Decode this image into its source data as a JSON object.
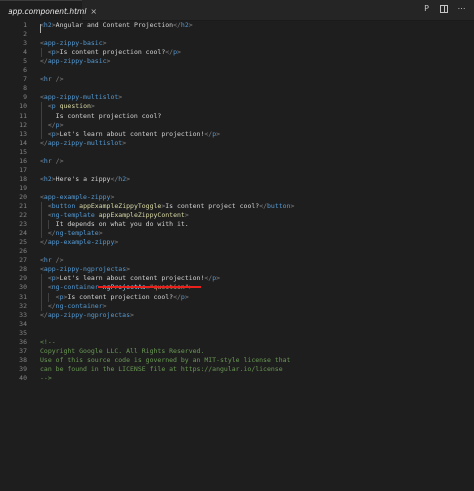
{
  "tab": {
    "filename": "app.component.html",
    "close": "×"
  },
  "toolbar": {
    "preview_icon": "P",
    "split_icon": "split-editor",
    "more_icon": "⋯"
  },
  "lines": [
    {
      "n": "1",
      "code": [
        [
          "br",
          "<"
        ],
        [
          "t",
          "h2"
        ],
        [
          "br",
          ">"
        ],
        [
          "txt",
          "Angular and Content Projection"
        ],
        [
          "br",
          "</"
        ],
        [
          "t",
          "h2"
        ],
        [
          "br",
          ">"
        ]
      ]
    },
    {
      "n": "2",
      "code": []
    },
    {
      "n": "3",
      "code": [
        [
          "br",
          "<"
        ],
        [
          "t",
          "app-zippy-basic"
        ],
        [
          "br",
          ">"
        ]
      ]
    },
    {
      "n": "4",
      "code": [
        [
          "txt",
          "  "
        ],
        [
          "br",
          "<"
        ],
        [
          "t",
          "p"
        ],
        [
          "br",
          ">"
        ],
        [
          "txt",
          "Is content projection cool?"
        ],
        [
          "br",
          "</"
        ],
        [
          "t",
          "p"
        ],
        [
          "br",
          ">"
        ]
      ]
    },
    {
      "n": "5",
      "code": [
        [
          "br",
          "</"
        ],
        [
          "t",
          "app-zippy-basic"
        ],
        [
          "br",
          ">"
        ]
      ]
    },
    {
      "n": "6",
      "code": []
    },
    {
      "n": "7",
      "code": [
        [
          "br",
          "<"
        ],
        [
          "t",
          "hr"
        ],
        [
          "txt",
          " "
        ],
        [
          "br",
          "/>"
        ]
      ]
    },
    {
      "n": "8",
      "code": []
    },
    {
      "n": "9",
      "code": [
        [
          "br",
          "<"
        ],
        [
          "t",
          "app-zippy-multislot"
        ],
        [
          "br",
          ">"
        ]
      ]
    },
    {
      "n": "10",
      "code": [
        [
          "txt",
          "  "
        ],
        [
          "br",
          "<"
        ],
        [
          "t",
          "p"
        ],
        [
          "txt",
          " "
        ],
        [
          "dr",
          "question"
        ],
        [
          "br",
          ">"
        ]
      ]
    },
    {
      "n": "11",
      "code": [
        [
          "txt",
          "    Is content projection cool?"
        ]
      ]
    },
    {
      "n": "12",
      "code": [
        [
          "txt",
          "  "
        ],
        [
          "br",
          "</"
        ],
        [
          "t",
          "p"
        ],
        [
          "br",
          ">"
        ]
      ]
    },
    {
      "n": "13",
      "code": [
        [
          "txt",
          "  "
        ],
        [
          "br",
          "<"
        ],
        [
          "t",
          "p"
        ],
        [
          "br",
          ">"
        ],
        [
          "txt",
          "Let's learn about content projection!"
        ],
        [
          "br",
          "</"
        ],
        [
          "t",
          "p"
        ],
        [
          "br",
          ">"
        ]
      ]
    },
    {
      "n": "14",
      "code": [
        [
          "br",
          "</"
        ],
        [
          "t",
          "app-zippy-multislot"
        ],
        [
          "br",
          ">"
        ]
      ]
    },
    {
      "n": "15",
      "code": []
    },
    {
      "n": "16",
      "code": [
        [
          "br",
          "<"
        ],
        [
          "t",
          "hr"
        ],
        [
          "txt",
          " "
        ],
        [
          "br",
          "/>"
        ]
      ]
    },
    {
      "n": "17",
      "code": []
    },
    {
      "n": "18",
      "code": [
        [
          "br",
          "<"
        ],
        [
          "t",
          "h2"
        ],
        [
          "br",
          ">"
        ],
        [
          "txt",
          "Here's a zippy"
        ],
        [
          "br",
          "</"
        ],
        [
          "t",
          "h2"
        ],
        [
          "br",
          ">"
        ]
      ]
    },
    {
      "n": "19",
      "code": []
    },
    {
      "n": "20",
      "code": [
        [
          "br",
          "<"
        ],
        [
          "t",
          "app-example-zippy"
        ],
        [
          "br",
          ">"
        ]
      ]
    },
    {
      "n": "21",
      "code": [
        [
          "txt",
          "  "
        ],
        [
          "br",
          "<"
        ],
        [
          "t",
          "button"
        ],
        [
          "txt",
          " "
        ],
        [
          "dr",
          "appExampleZippyToggle"
        ],
        [
          "br",
          ">"
        ],
        [
          "txt",
          "Is content project cool?"
        ],
        [
          "br",
          "</"
        ],
        [
          "t",
          "button"
        ],
        [
          "br",
          ">"
        ]
      ]
    },
    {
      "n": "22",
      "code": [
        [
          "txt",
          "  "
        ],
        [
          "br",
          "<"
        ],
        [
          "t",
          "ng-template"
        ],
        [
          "txt",
          " "
        ],
        [
          "dr",
          "appExampleZippyContent"
        ],
        [
          "br",
          ">"
        ]
      ]
    },
    {
      "n": "23",
      "code": [
        [
          "txt",
          "    It depends on what you do with it."
        ]
      ]
    },
    {
      "n": "24",
      "code": [
        [
          "txt",
          "  "
        ],
        [
          "br",
          "</"
        ],
        [
          "t",
          "ng-template"
        ],
        [
          "br",
          ">"
        ]
      ]
    },
    {
      "n": "25",
      "code": [
        [
          "br",
          "</"
        ],
        [
          "t",
          "app-example-zippy"
        ],
        [
          "br",
          ">"
        ]
      ]
    },
    {
      "n": "26",
      "code": []
    },
    {
      "n": "27",
      "code": [
        [
          "br",
          "<"
        ],
        [
          "t",
          "hr"
        ],
        [
          "txt",
          " "
        ],
        [
          "br",
          "/>"
        ]
      ]
    },
    {
      "n": "28",
      "code": [
        [
          "br",
          "<"
        ],
        [
          "t",
          "app-zippy-ngprojectas"
        ],
        [
          "br",
          ">"
        ]
      ]
    },
    {
      "n": "29",
      "code": [
        [
          "txt",
          "  "
        ],
        [
          "br",
          "<"
        ],
        [
          "t",
          "p"
        ],
        [
          "br",
          ">"
        ],
        [
          "txt",
          "Let's learn about content projection!"
        ],
        [
          "br",
          "</"
        ],
        [
          "t",
          "p"
        ],
        [
          "br",
          ">"
        ]
      ]
    },
    {
      "n": "30",
      "code": [
        [
          "txt",
          "  "
        ],
        [
          "br",
          "<"
        ],
        [
          "t",
          "ng-container"
        ],
        [
          "txt",
          " "
        ],
        [
          "at",
          "ngProjectAs"
        ],
        [
          "txt",
          "="
        ],
        [
          "st",
          "\"question\""
        ],
        [
          "br",
          ">"
        ]
      ]
    },
    {
      "n": "31",
      "code": [
        [
          "txt",
          "    "
        ],
        [
          "br",
          "<"
        ],
        [
          "t",
          "p"
        ],
        [
          "br",
          ">"
        ],
        [
          "txt",
          "Is content projection cool?"
        ],
        [
          "br",
          "</"
        ],
        [
          "t",
          "p"
        ],
        [
          "br",
          ">"
        ]
      ]
    },
    {
      "n": "32",
      "code": [
        [
          "txt",
          "  "
        ],
        [
          "br",
          "</"
        ],
        [
          "t",
          "ng-container"
        ],
        [
          "br",
          ">"
        ]
      ]
    },
    {
      "n": "33",
      "code": [
        [
          "br",
          "</"
        ],
        [
          "t",
          "app-zippy-ngprojectas"
        ],
        [
          "br",
          ">"
        ]
      ]
    },
    {
      "n": "34",
      "code": []
    },
    {
      "n": "35",
      "code": []
    },
    {
      "n": "36",
      "code": [
        [
          "cm",
          "<!--"
        ]
      ]
    },
    {
      "n": "37",
      "code": [
        [
          "cm",
          "Copyright Google LLC. All Rights Reserved."
        ]
      ]
    },
    {
      "n": "38",
      "code": [
        [
          "cm",
          "Use of this source code is governed by an MIT-style license that"
        ]
      ]
    },
    {
      "n": "39",
      "code": [
        [
          "cm",
          "can be found in the LICENSE file at https://angular.io/license"
        ]
      ]
    },
    {
      "n": "40",
      "code": [
        [
          "cm",
          "-->"
        ]
      ]
    }
  ],
  "colors": {
    "background": "#1e1e1e",
    "tag": "#569cd6",
    "attribute": "#9cdcfe",
    "directive": "#dcdcaa",
    "string": "#ce9178",
    "comment": "#6a9955",
    "annotation_underline": "#e8211d"
  }
}
